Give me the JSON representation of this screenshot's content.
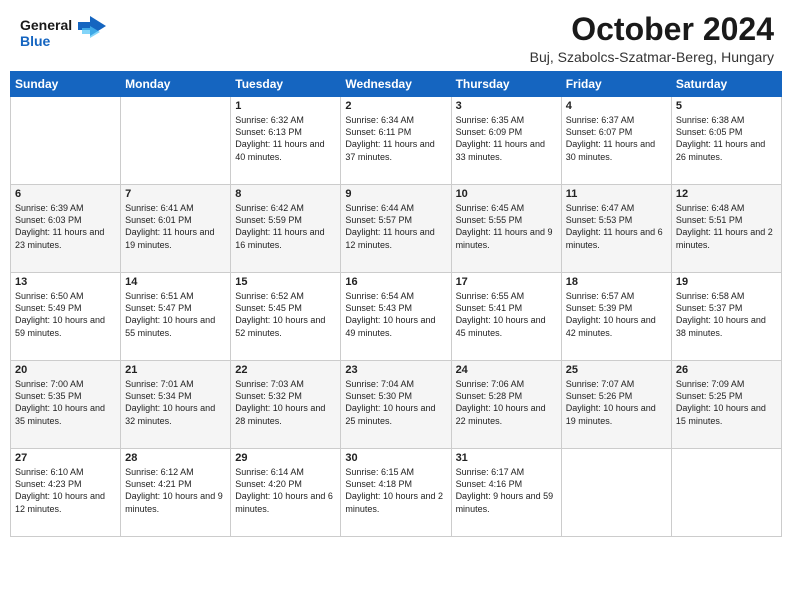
{
  "header": {
    "logo_line1": "General",
    "logo_line2": "Blue",
    "month": "October 2024",
    "location": "Buj, Szabolcs-Szatmar-Bereg, Hungary"
  },
  "days_of_week": [
    "Sunday",
    "Monday",
    "Tuesday",
    "Wednesday",
    "Thursday",
    "Friday",
    "Saturday"
  ],
  "weeks": [
    [
      {
        "day": "",
        "text": ""
      },
      {
        "day": "",
        "text": ""
      },
      {
        "day": "1",
        "text": "Sunrise: 6:32 AM\nSunset: 6:13 PM\nDaylight: 11 hours and 40 minutes."
      },
      {
        "day": "2",
        "text": "Sunrise: 6:34 AM\nSunset: 6:11 PM\nDaylight: 11 hours and 37 minutes."
      },
      {
        "day": "3",
        "text": "Sunrise: 6:35 AM\nSunset: 6:09 PM\nDaylight: 11 hours and 33 minutes."
      },
      {
        "day": "4",
        "text": "Sunrise: 6:37 AM\nSunset: 6:07 PM\nDaylight: 11 hours and 30 minutes."
      },
      {
        "day": "5",
        "text": "Sunrise: 6:38 AM\nSunset: 6:05 PM\nDaylight: 11 hours and 26 minutes."
      }
    ],
    [
      {
        "day": "6",
        "text": "Sunrise: 6:39 AM\nSunset: 6:03 PM\nDaylight: 11 hours and 23 minutes."
      },
      {
        "day": "7",
        "text": "Sunrise: 6:41 AM\nSunset: 6:01 PM\nDaylight: 11 hours and 19 minutes."
      },
      {
        "day": "8",
        "text": "Sunrise: 6:42 AM\nSunset: 5:59 PM\nDaylight: 11 hours and 16 minutes."
      },
      {
        "day": "9",
        "text": "Sunrise: 6:44 AM\nSunset: 5:57 PM\nDaylight: 11 hours and 12 minutes."
      },
      {
        "day": "10",
        "text": "Sunrise: 6:45 AM\nSunset: 5:55 PM\nDaylight: 11 hours and 9 minutes."
      },
      {
        "day": "11",
        "text": "Sunrise: 6:47 AM\nSunset: 5:53 PM\nDaylight: 11 hours and 6 minutes."
      },
      {
        "day": "12",
        "text": "Sunrise: 6:48 AM\nSunset: 5:51 PM\nDaylight: 11 hours and 2 minutes."
      }
    ],
    [
      {
        "day": "13",
        "text": "Sunrise: 6:50 AM\nSunset: 5:49 PM\nDaylight: 10 hours and 59 minutes."
      },
      {
        "day": "14",
        "text": "Sunrise: 6:51 AM\nSunset: 5:47 PM\nDaylight: 10 hours and 55 minutes."
      },
      {
        "day": "15",
        "text": "Sunrise: 6:52 AM\nSunset: 5:45 PM\nDaylight: 10 hours and 52 minutes."
      },
      {
        "day": "16",
        "text": "Sunrise: 6:54 AM\nSunset: 5:43 PM\nDaylight: 10 hours and 49 minutes."
      },
      {
        "day": "17",
        "text": "Sunrise: 6:55 AM\nSunset: 5:41 PM\nDaylight: 10 hours and 45 minutes."
      },
      {
        "day": "18",
        "text": "Sunrise: 6:57 AM\nSunset: 5:39 PM\nDaylight: 10 hours and 42 minutes."
      },
      {
        "day": "19",
        "text": "Sunrise: 6:58 AM\nSunset: 5:37 PM\nDaylight: 10 hours and 38 minutes."
      }
    ],
    [
      {
        "day": "20",
        "text": "Sunrise: 7:00 AM\nSunset: 5:35 PM\nDaylight: 10 hours and 35 minutes."
      },
      {
        "day": "21",
        "text": "Sunrise: 7:01 AM\nSunset: 5:34 PM\nDaylight: 10 hours and 32 minutes."
      },
      {
        "day": "22",
        "text": "Sunrise: 7:03 AM\nSunset: 5:32 PM\nDaylight: 10 hours and 28 minutes."
      },
      {
        "day": "23",
        "text": "Sunrise: 7:04 AM\nSunset: 5:30 PM\nDaylight: 10 hours and 25 minutes."
      },
      {
        "day": "24",
        "text": "Sunrise: 7:06 AM\nSunset: 5:28 PM\nDaylight: 10 hours and 22 minutes."
      },
      {
        "day": "25",
        "text": "Sunrise: 7:07 AM\nSunset: 5:26 PM\nDaylight: 10 hours and 19 minutes."
      },
      {
        "day": "26",
        "text": "Sunrise: 7:09 AM\nSunset: 5:25 PM\nDaylight: 10 hours and 15 minutes."
      }
    ],
    [
      {
        "day": "27",
        "text": "Sunrise: 6:10 AM\nSunset: 4:23 PM\nDaylight: 10 hours and 12 minutes."
      },
      {
        "day": "28",
        "text": "Sunrise: 6:12 AM\nSunset: 4:21 PM\nDaylight: 10 hours and 9 minutes."
      },
      {
        "day": "29",
        "text": "Sunrise: 6:14 AM\nSunset: 4:20 PM\nDaylight: 10 hours and 6 minutes."
      },
      {
        "day": "30",
        "text": "Sunrise: 6:15 AM\nSunset: 4:18 PM\nDaylight: 10 hours and 2 minutes."
      },
      {
        "day": "31",
        "text": "Sunrise: 6:17 AM\nSunset: 4:16 PM\nDaylight: 9 hours and 59 minutes."
      },
      {
        "day": "",
        "text": ""
      },
      {
        "day": "",
        "text": ""
      }
    ]
  ]
}
